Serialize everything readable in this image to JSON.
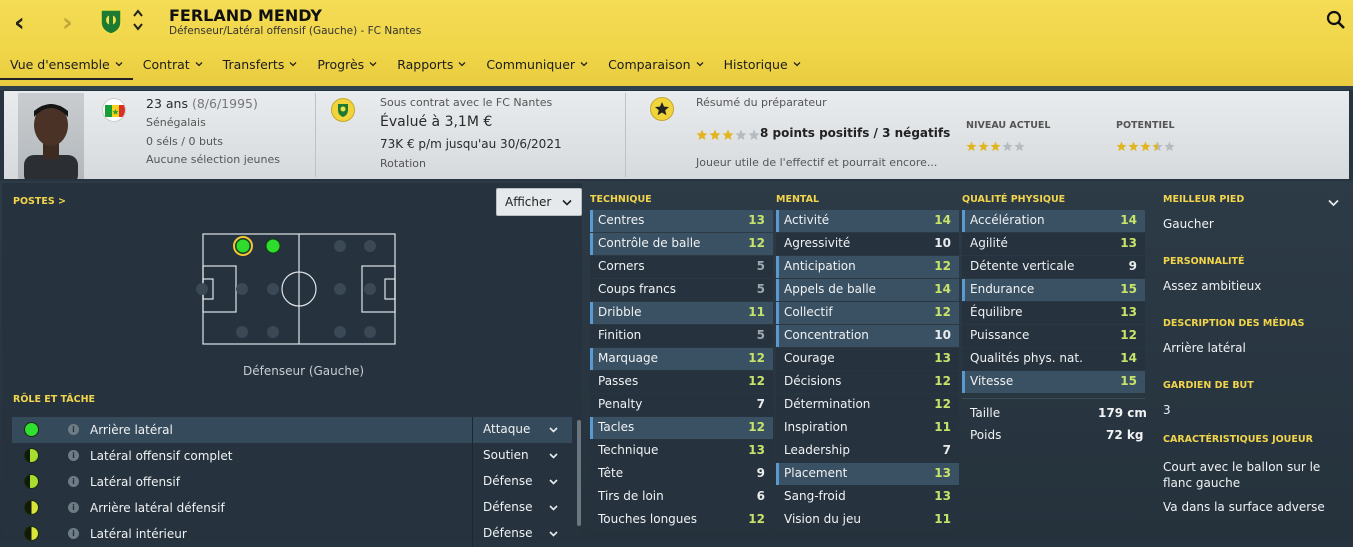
{
  "header": {
    "name": "FERLAND MENDY",
    "subtitle": "Défenseur/Latéral offensif (Gauche) - FC Nantes",
    "back_icon": "chevron-left-icon",
    "forward_icon": "chevron-right-icon",
    "club_crest": "club-crest-icon",
    "search_icon": "search-icon",
    "bg_color": "#f0d548"
  },
  "menu": [
    {
      "label": "Vue d'ensemble",
      "active": true
    },
    {
      "label": "Contrat"
    },
    {
      "label": "Transferts"
    },
    {
      "label": "Progrès"
    },
    {
      "label": "Rapports"
    },
    {
      "label": "Communiquer"
    },
    {
      "label": "Comparaison"
    },
    {
      "label": "Historique"
    }
  ],
  "summary": {
    "age": "23 ans",
    "dob": "(8/6/1995)",
    "nationality": "Sénégalais",
    "caps": "0 séls / 0 buts",
    "youth": "Aucune sélection jeunes",
    "contract_with": "Sous contrat avec le FC Nantes",
    "value": "Évalué à 3,1M €",
    "wage": "73K € p/m jusqu'au 30/6/2021",
    "status": "Rotation",
    "report_title": "Résumé du préparateur",
    "report_points": "8 points positifs / 3 négatifs",
    "report_stars": 3,
    "report_text": "Joueur utile de l'effectif et pourrait encore...",
    "current_label": "NIVEAU ACTUEL",
    "current_stars": 3,
    "potential_label": "POTENTIEL",
    "potential_stars": 3.5
  },
  "positions": {
    "title": "POSTES",
    "title_arrow": ">",
    "show_button": "Afficher",
    "position_text": "Défenseur (Gauche)"
  },
  "roles": {
    "title": "RÔLE ET TÂCHE",
    "items": [
      {
        "name": "Arrière latéral",
        "duty": "Attaque",
        "fit": "full"
      },
      {
        "name": "Latéral offensif complet",
        "duty": "Soutien",
        "fit": "half"
      },
      {
        "name": "Latéral offensif",
        "duty": "Défense",
        "fit": "half"
      },
      {
        "name": "Arrière latéral défensif",
        "duty": "Défense",
        "fit": "partial"
      },
      {
        "name": "Latéral intérieur",
        "duty": "Défense",
        "fit": "partial"
      }
    ]
  },
  "technique": {
    "title": "TECHNIQUE",
    "attrs": [
      {
        "name": "Centres",
        "value": 13,
        "hl": true
      },
      {
        "name": "Contrôle de balle",
        "value": 12,
        "hl": true
      },
      {
        "name": "Corners",
        "value": 5
      },
      {
        "name": "Coups francs",
        "value": 5
      },
      {
        "name": "Dribble",
        "value": 11,
        "hl": true
      },
      {
        "name": "Finition",
        "value": 5
      },
      {
        "name": "Marquage",
        "value": 12,
        "hl": true
      },
      {
        "name": "Passes",
        "value": 12
      },
      {
        "name": "Penalty",
        "value": 7
      },
      {
        "name": "Tacles",
        "value": 12,
        "hl": true
      },
      {
        "name": "Technique",
        "value": 13
      },
      {
        "name": "Tête",
        "value": 9
      },
      {
        "name": "Tirs de loin",
        "value": 6
      },
      {
        "name": "Touches longues",
        "value": 12
      }
    ]
  },
  "mental": {
    "title": "MENTAL",
    "attrs": [
      {
        "name": "Activité",
        "value": 14,
        "hl": true
      },
      {
        "name": "Agressivité",
        "value": 10
      },
      {
        "name": "Anticipation",
        "value": 12,
        "hl": true
      },
      {
        "name": "Appels de balle",
        "value": 14,
        "hl": true
      },
      {
        "name": "Collectif",
        "value": 12,
        "hl": true
      },
      {
        "name": "Concentration",
        "value": 10,
        "hl": true
      },
      {
        "name": "Courage",
        "value": 13
      },
      {
        "name": "Décisions",
        "value": 12
      },
      {
        "name": "Détermination",
        "value": 12
      },
      {
        "name": "Inspiration",
        "value": 11
      },
      {
        "name": "Leadership",
        "value": 7
      },
      {
        "name": "Placement",
        "value": 13,
        "hl": true
      },
      {
        "name": "Sang-froid",
        "value": 13
      },
      {
        "name": "Vision du jeu",
        "value": 11
      }
    ]
  },
  "physical": {
    "title": "QUALITÉ PHYSIQUE",
    "attrs": [
      {
        "name": "Accélération",
        "value": 14,
        "hl": true
      },
      {
        "name": "Agilité",
        "value": 13
      },
      {
        "name": "Détente verticale",
        "value": 9
      },
      {
        "name": "Endurance",
        "value": 15,
        "hl": true
      },
      {
        "name": "Équilibre",
        "value": 13
      },
      {
        "name": "Puissance",
        "value": 12
      },
      {
        "name": "Qualités phys. nat.",
        "value": 14
      },
      {
        "name": "Vitesse",
        "value": 15,
        "hl": true
      }
    ],
    "height_label": "Taille",
    "height": "179 cm",
    "weight_label": "Poids",
    "weight": "72 kg"
  },
  "info": {
    "foot_title": "MEILLEUR PIED",
    "foot": "Gaucher",
    "personality_title": "PERSONNALITÉ",
    "personality": "Assez ambitieux",
    "media_title": "DESCRIPTION DES MÉDIAS",
    "media": "Arrière latéral",
    "gk_title": "GARDIEN DE BUT",
    "gk": "3",
    "traits_title": "CARACTÉRISTIQUES JOUEUR",
    "trait1": "Court avec le ballon sur le flanc gauche",
    "trait2": "Va dans la surface adverse"
  }
}
